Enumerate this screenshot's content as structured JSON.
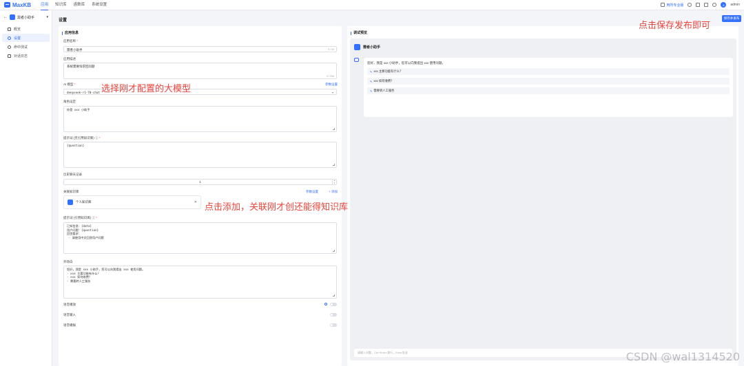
{
  "header": {
    "brand": "MaxKB",
    "nav": [
      "应用",
      "知识库",
      "函数库",
      "系统设置"
    ],
    "right_link": "用所专业版",
    "user": "admin"
  },
  "sidebar": {
    "app_name": "需者小助手",
    "items": [
      {
        "label": "概览",
        "icon": "grid-icon"
      },
      {
        "label": "设置",
        "icon": "gear-icon"
      },
      {
        "label": "命中测试",
        "icon": "target-icon"
      },
      {
        "label": "对话日志",
        "icon": "log-icon"
      }
    ]
  },
  "page": {
    "title": "设置",
    "save_button": "保存并发布"
  },
  "form": {
    "section_title": "应用信息",
    "name_label": "应用名称",
    "name_value": "需者小助手",
    "name_counter": "5 / 64",
    "desc_label": "应用描述",
    "desc_value": "系统需要询求回问题",
    "desc_counter": "9 / 256",
    "model_label": "AI 模型",
    "model_link": "参数设置",
    "model_value": "deepseek-r1-70-chat",
    "role_label": "角色设定",
    "role_value": "你是 xxx 小助手",
    "prompt_nokb_label": "提示词 (无引用知识库)",
    "prompt_nokb_value": "{question}",
    "history_label": "历史聊天记录",
    "history_value": "1",
    "kb_label": "关联知识库",
    "kb_param_link": "参数设置",
    "kb_add_link": "+ 添加",
    "kb_item": "个人知识库",
    "prompt_kb_label": "提示词 (引用知识库)",
    "prompt_kb_value": "已知信息：{data}\n用户问题：{question}\n回答要求：\n - 请使用中文回答用户问题",
    "prologue_label": "开场白",
    "prologue_value": "您好，我是 xxx 小助手，您可以向我提出 xxx 使用问题。\n- xxx 主要功能有什么？\n- xxx 如何收费？\n- 需要转人工服务",
    "switches": [
      "语音播放",
      "语音输入",
      "语音播报"
    ]
  },
  "preview": {
    "title": "调试预览",
    "app_name": "需者小助手",
    "prologue": "您好，我是 xxx 小助手，您可以向我提出 xxx 使用问题。",
    "chips": [
      "xxx 主要功能有什么？",
      "xxx 如何收费？",
      "需要转人工服务"
    ],
    "input_placeholder": "请输入问题，Ctrl+Enter 换行，Enter发送"
  },
  "annotations": {
    "select_model": "选择刚才配置的大模型",
    "add_kb": "点击添加，关联刚才创还能得知识库",
    "save_publish": "点击保存发布即可"
  },
  "watermark": "CSDN @wal1314520",
  "colors": {
    "accent": "#3370ff",
    "annotation": "#e8453c"
  }
}
